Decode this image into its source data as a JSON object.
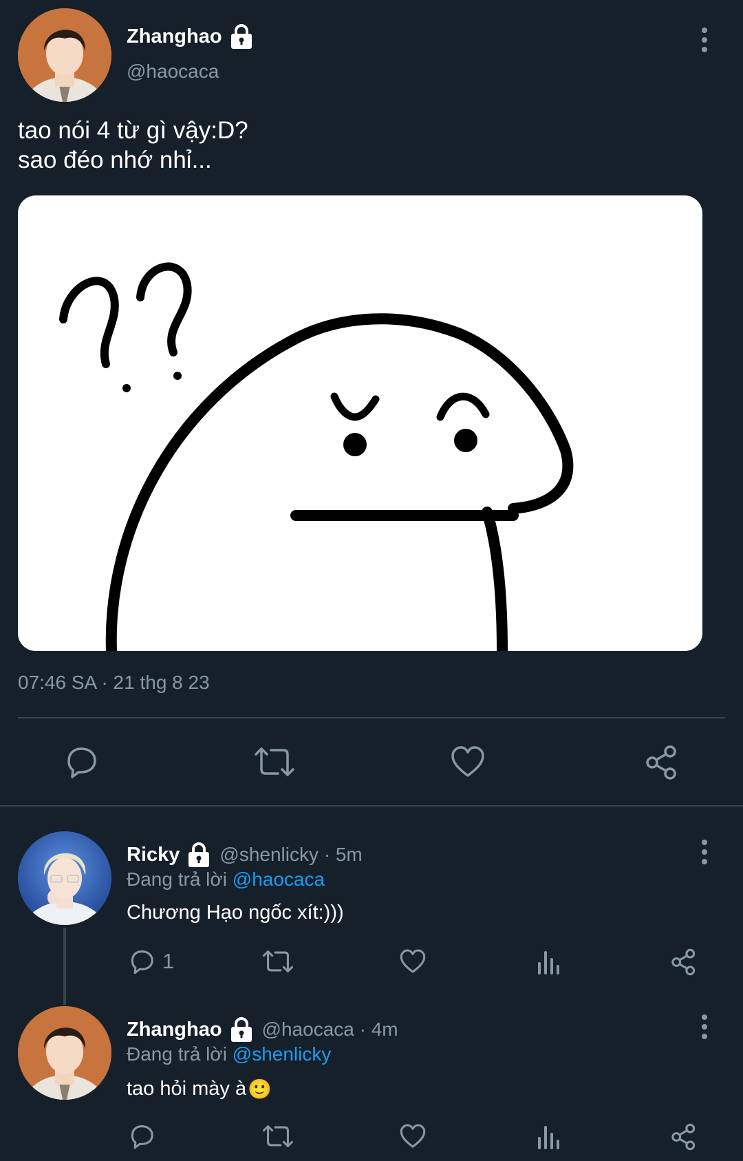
{
  "main_tweet": {
    "author_name": "Zhanghao",
    "author_handle": "@haocaca",
    "text_line1": "tao nói 4 từ gì vậy:D?",
    "text_line2": "sao đéo nhớ nhỉ...",
    "timestamp": "07:46 SA · 21 thg 8 23",
    "locked": true
  },
  "replies": [
    {
      "author_name": "Ricky",
      "meta": "@shenlicky · 5m",
      "replying_prefix": "Đang trả lời",
      "replying_to": "@haocaca",
      "text": "Chương Hạo ngốc xít:)))",
      "reply_count": "1",
      "locked": true
    },
    {
      "author_name": "Zhanghao",
      "meta": "@haocaca · 4m",
      "replying_prefix": "Đang trả lời",
      "replying_to": "@shenlicky",
      "text": "tao hỏi mày à",
      "emoji": "🙂",
      "locked": true
    }
  ],
  "icons": {
    "reply": "reply-icon",
    "retweet": "retweet-icon",
    "like": "heart-icon",
    "share": "share-icon",
    "analytics": "analytics-icon",
    "more": "more-options-icon",
    "lock": "lock-icon"
  },
  "colors": {
    "background": "#15202b",
    "muted": "#8899a6",
    "link": "#1d9bf0",
    "divider": "#38444d"
  }
}
